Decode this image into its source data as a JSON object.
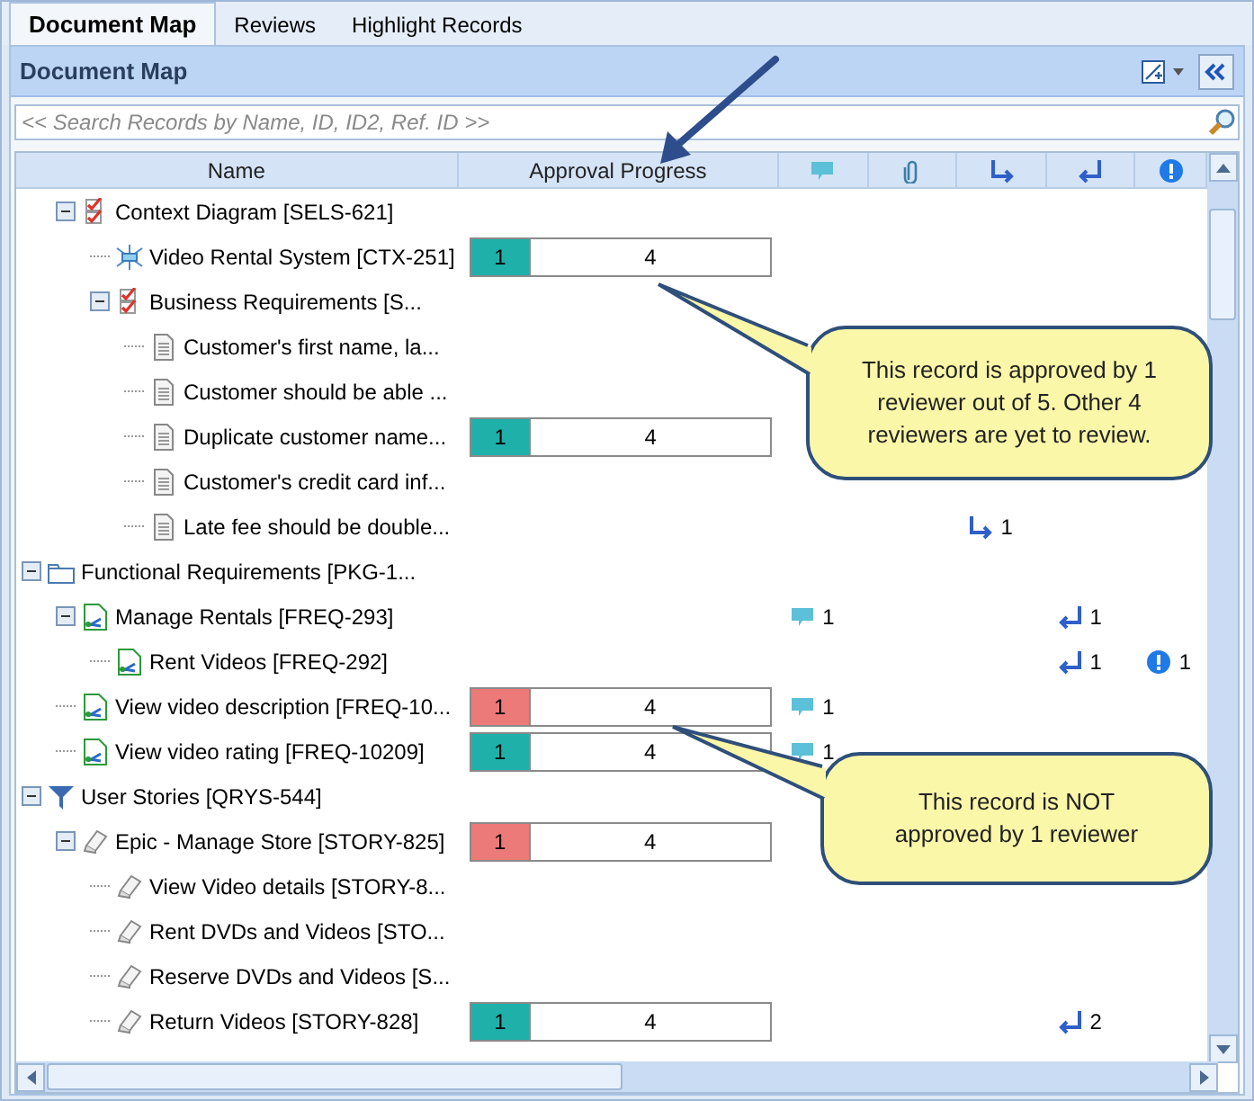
{
  "tabs": [
    {
      "label": "Document Map",
      "selected": true
    },
    {
      "label": "Reviews",
      "selected": false
    },
    {
      "label": "Highlight Records",
      "selected": false
    }
  ],
  "panel": {
    "title": "Document Map"
  },
  "search": {
    "placeholder": "<< Search Records by Name, ID, ID2, Ref. ID >>"
  },
  "columns": [
    {
      "kind": "text",
      "label": "Name"
    },
    {
      "kind": "text",
      "label": "Approval Progress"
    },
    {
      "kind": "comments"
    },
    {
      "kind": "attachments"
    },
    {
      "kind": "outlinks"
    },
    {
      "kind": "inlinks"
    },
    {
      "kind": "issues"
    }
  ],
  "tree": [
    {
      "children": [
        {
          "label": "Context Diagram [SELS-621]",
          "kind": "checklist",
          "expanded": true,
          "children": [
            {
              "label": "Video Rental System [CTX-251]",
              "kind": "context",
              "approval": {
                "kind": "approved",
                "count": "1",
                "level": 0.2,
                "pending": "4"
              }
            },
            {
              "label": "Business Requirements [S...",
              "kind": "checklist",
              "expanded": true,
              "children": [
                {
                  "label": "Customer's first name, la...",
                  "kind": "doc"
                },
                {
                  "label": "Customer should be able ...",
                  "kind": "doc"
                },
                {
                  "label": "Duplicate customer name...",
                  "kind": "doc",
                  "approval": {
                    "kind": "approved",
                    "count": "1",
                    "level": 0.2,
                    "pending": "4"
                  }
                },
                {
                  "label": "Customer's credit card inf...",
                  "kind": "doc"
                },
                {
                  "label": "Late fee should be double...",
                  "kind": "doc",
                  "outlinks": "1"
                }
              ]
            }
          ]
        }
      ]
    },
    {
      "label": "Functional Requirements [PKG-1...",
      "kind": "folder",
      "expanded": true,
      "children": [
        {
          "label": "Manage Rentals [FREQ-293]",
          "kind": "requirement",
          "expanded": true,
          "comments": "1",
          "inlinks": "1",
          "children": [
            {
              "label": "Rent Videos [FREQ-292]",
              "kind": "requirement",
              "inlinks": "1",
              "issues": "1"
            }
          ]
        },
        {
          "label": "View video description [FREQ-10...",
          "kind": "requirement",
          "approval": {
            "kind": "rejected",
            "count": "1",
            "level": 0.2,
            "pending": "4"
          },
          "comments": "1"
        },
        {
          "label": "View video rating [FREQ-10209]",
          "kind": "requirement",
          "approval": {
            "kind": "approved",
            "count": "1",
            "level": 0.2,
            "pending": "4"
          },
          "comments": "1"
        }
      ]
    },
    {
      "label": "User Stories [QRYS-544]",
      "kind": "filter",
      "expanded": true,
      "children": [
        {
          "label": "Epic - Manage Store [STORY-825]",
          "kind": "story",
          "expanded": true,
          "approval": {
            "kind": "rejected",
            "count": "1",
            "level": 0.2,
            "pending": "4"
          },
          "children": [
            {
              "label": "View Video details [STORY-8...",
              "kind": "story"
            },
            {
              "label": "Rent DVDs and Videos [STO...",
              "kind": "story"
            },
            {
              "label": "Reserve DVDs and Videos [S...",
              "kind": "story"
            },
            {
              "label": "Return Videos [STORY-828]",
              "kind": "story",
              "approval": {
                "kind": "approved",
                "count": "1",
                "level": 0.2,
                "pending": "4"
              },
              "inlinks": "2"
            }
          ]
        }
      ]
    }
  ],
  "callouts": [
    {
      "text": "This record is approved by 1 reviewer out of 5. Other 4 reviewers are yet to review."
    },
    {
      "text": "This record is NOT approved by 1 reviewer"
    }
  ]
}
